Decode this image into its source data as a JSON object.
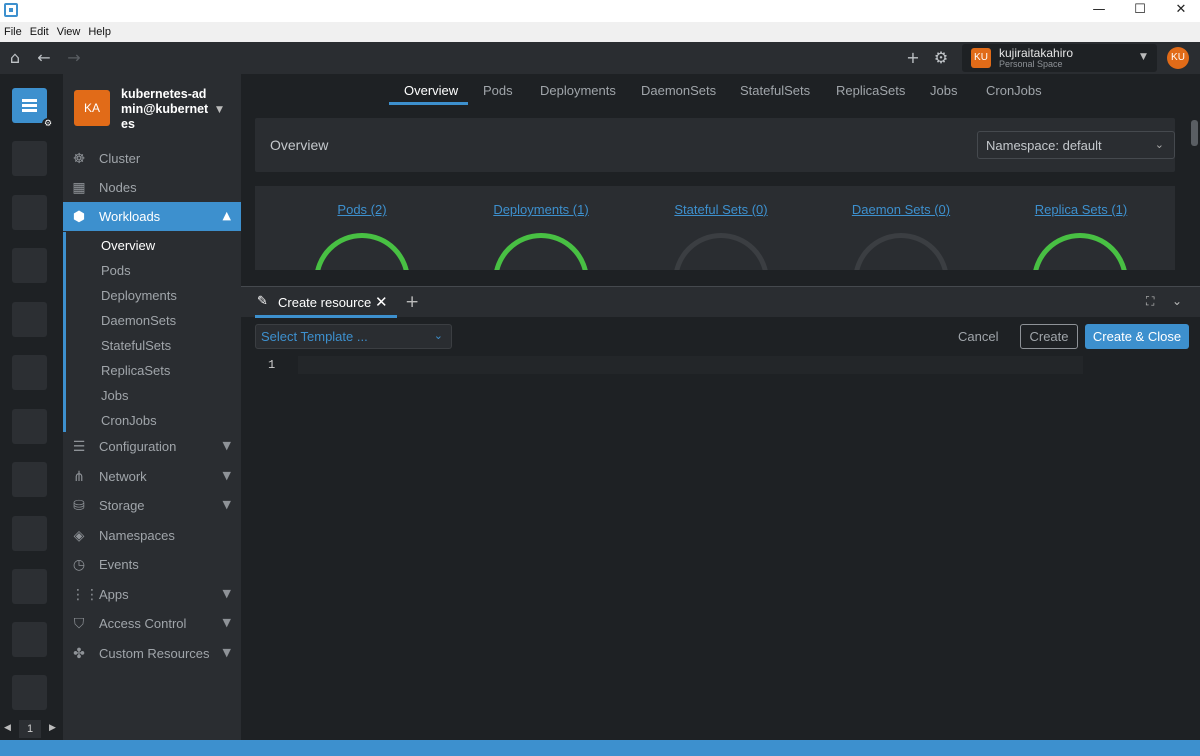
{
  "window": {
    "minimize": "—",
    "maximize": "☐",
    "close": "✕"
  },
  "menu": [
    "File",
    "Edit",
    "View",
    "Help"
  ],
  "topbar": {
    "space": {
      "avatar": "KU",
      "name": "kujiraitakahiro",
      "subtitle": "Personal Space"
    },
    "user_avatar": "KU"
  },
  "hotbar": {
    "page": "1"
  },
  "cluster": {
    "avatar": "KA",
    "name": "kubernetes-admin@kubernetes"
  },
  "nav": {
    "cluster": "Cluster",
    "nodes": "Nodes",
    "workloads": "Workloads",
    "sub": [
      "Overview",
      "Pods",
      "Deployments",
      "DaemonSets",
      "StatefulSets",
      "ReplicaSets",
      "Jobs",
      "CronJobs"
    ],
    "configuration": "Configuration",
    "network": "Network",
    "storage": "Storage",
    "namespaces": "Namespaces",
    "events": "Events",
    "apps": "Apps",
    "access_control": "Access Control",
    "custom_resources": "Custom Resources"
  },
  "tabs": [
    "Overview",
    "Pods",
    "Deployments",
    "DaemonSets",
    "StatefulSets",
    "ReplicaSets",
    "Jobs",
    "CronJobs"
  ],
  "overview": {
    "title": "Overview",
    "namespace_select": "Namespace: default",
    "stats": [
      {
        "label": "Pods (2)",
        "status": "ok"
      },
      {
        "label": "Deployments (1)",
        "status": "ok"
      },
      {
        "label": "Stateful Sets (0)",
        "status": "empty"
      },
      {
        "label": "Daemon Sets (0)",
        "status": "empty"
      },
      {
        "label": "Replica Sets (1)",
        "status": "ok"
      }
    ]
  },
  "dock": {
    "tab_label": "Create resource",
    "template_placeholder": "Select Template ...",
    "cancel": "Cancel",
    "create": "Create",
    "create_close": "Create & Close",
    "line_number": "1"
  },
  "colors": {
    "accent": "#3d90ce",
    "orange": "#e16b18",
    "ok": "#48c043"
  }
}
